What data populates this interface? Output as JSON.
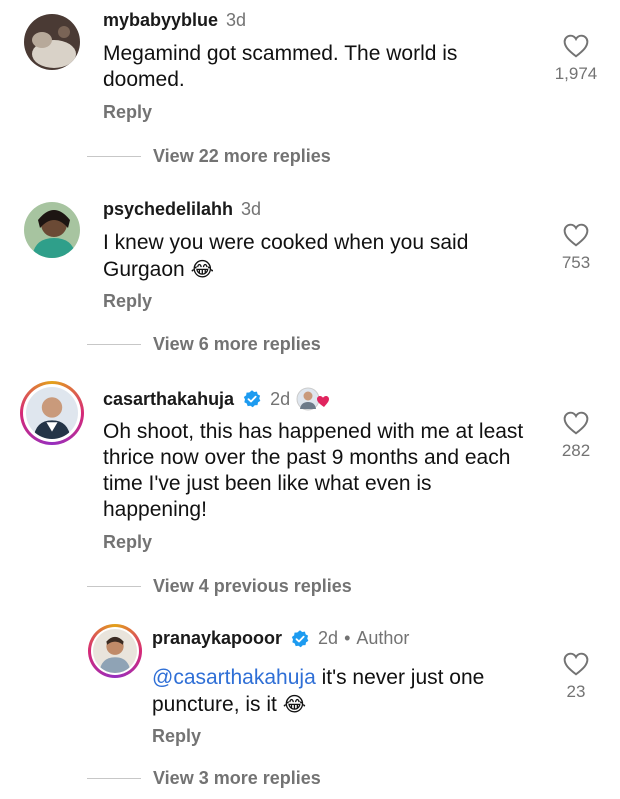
{
  "comments": [
    {
      "username": "mybabyyblue",
      "time": "3d",
      "text": "Megamind got scammed. The world is doomed.",
      "reply_label": "Reply",
      "likes": "1,974",
      "more_replies": "View 22 more replies"
    },
    {
      "username": "psychedelilahh",
      "time": "3d",
      "text": "I knew you were cooked when you said Gurgaon",
      "emoji": "😂",
      "reply_label": "Reply",
      "likes": "753",
      "more_replies": "View 6 more replies"
    },
    {
      "username": "casarthakahuja",
      "time": "2d",
      "text": "Oh shoot, this has happened with me at least thrice now over the past 9 months and each time I've just been like what even is happening!",
      "reply_label": "Reply",
      "likes": "282",
      "previous_replies": "View 4 previous replies"
    },
    {
      "username": "pranaykapooor",
      "time": "2d",
      "dot": "•",
      "author_label": "Author",
      "mention": "@casarthakahuja",
      "text": " it's never just one puncture, is it",
      "emoji": "😂",
      "reply_label": "Reply",
      "likes": "23",
      "more_replies": "View 3 more replies"
    }
  ],
  "colors": {
    "verified": "#1d9bf0",
    "like_heart": "#e0245e",
    "mention": "#2f6fd6"
  }
}
